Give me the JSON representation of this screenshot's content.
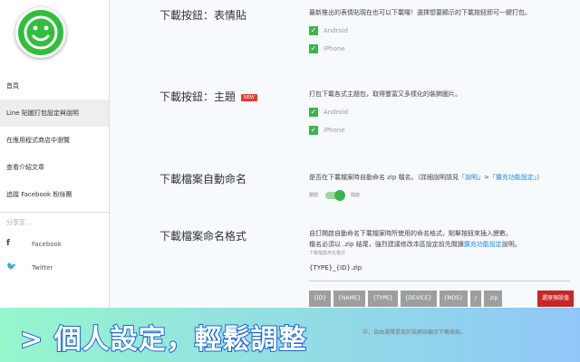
{
  "sidebar": {
    "items": [
      "首頁",
      "Line 貼圖打包設定與說明",
      "在應用程式商店中瀏覽",
      "查看介紹文章",
      "追蹤 Facebook 粉絲團"
    ],
    "share_label": "分享至...",
    "social": [
      "Facebook",
      "Twitter"
    ]
  },
  "sections": {
    "sticker": {
      "label": "下載按鈕：表情貼",
      "desc": "最新推出的表情貼現在也可以下載囉！選擇想要顯示的下載按鈕即可一鍵打包。",
      "options": [
        "Android",
        "iPhone"
      ]
    },
    "theme": {
      "label": "下載按鈕：主題",
      "badge": "NEW",
      "desc": "打包下載各式主題包，取得豐富又多樣化的裝飾圖片。",
      "options": [
        "Android",
        "iPhone"
      ]
    },
    "autoname": {
      "label": "下載檔案自動命名",
      "desc_pre": "是否在下載檔案時自動命名 zip 檔名。（詳細說明請見",
      "link1": "「說明」",
      "sep": ">",
      "link2": "「擴充功能設定」",
      "desc_post": "）",
      "off": "關閉",
      "on": "開啟"
    },
    "format": {
      "label": "下載檔案命名格式",
      "desc1": "自訂開啟自動命名下載檔案時所使用的命名格式，點擊按鈕來插入變數。",
      "desc2_pre": "檔名必須以 .zip 結尾，強烈建議修改本區設定前先閱讀",
      "desc2_link": "擴充功能設定",
      "desc2_post": "說明。",
      "field_label": "下載檔案命名格式",
      "value": "{TYPE}_{ID}.zip",
      "buttons": [
        "{ID}",
        "{NAME}",
        "{TYPE}",
        "{DEVICE}",
        "{MD5}",
        "/",
        ".zip"
      ],
      "reset": "還原預設值"
    }
  },
  "banner": {
    "text": "> 個人設定，輕鬆調整",
    "under": "中，自由選擇是否於該網站顯示下載按鈕。"
  }
}
